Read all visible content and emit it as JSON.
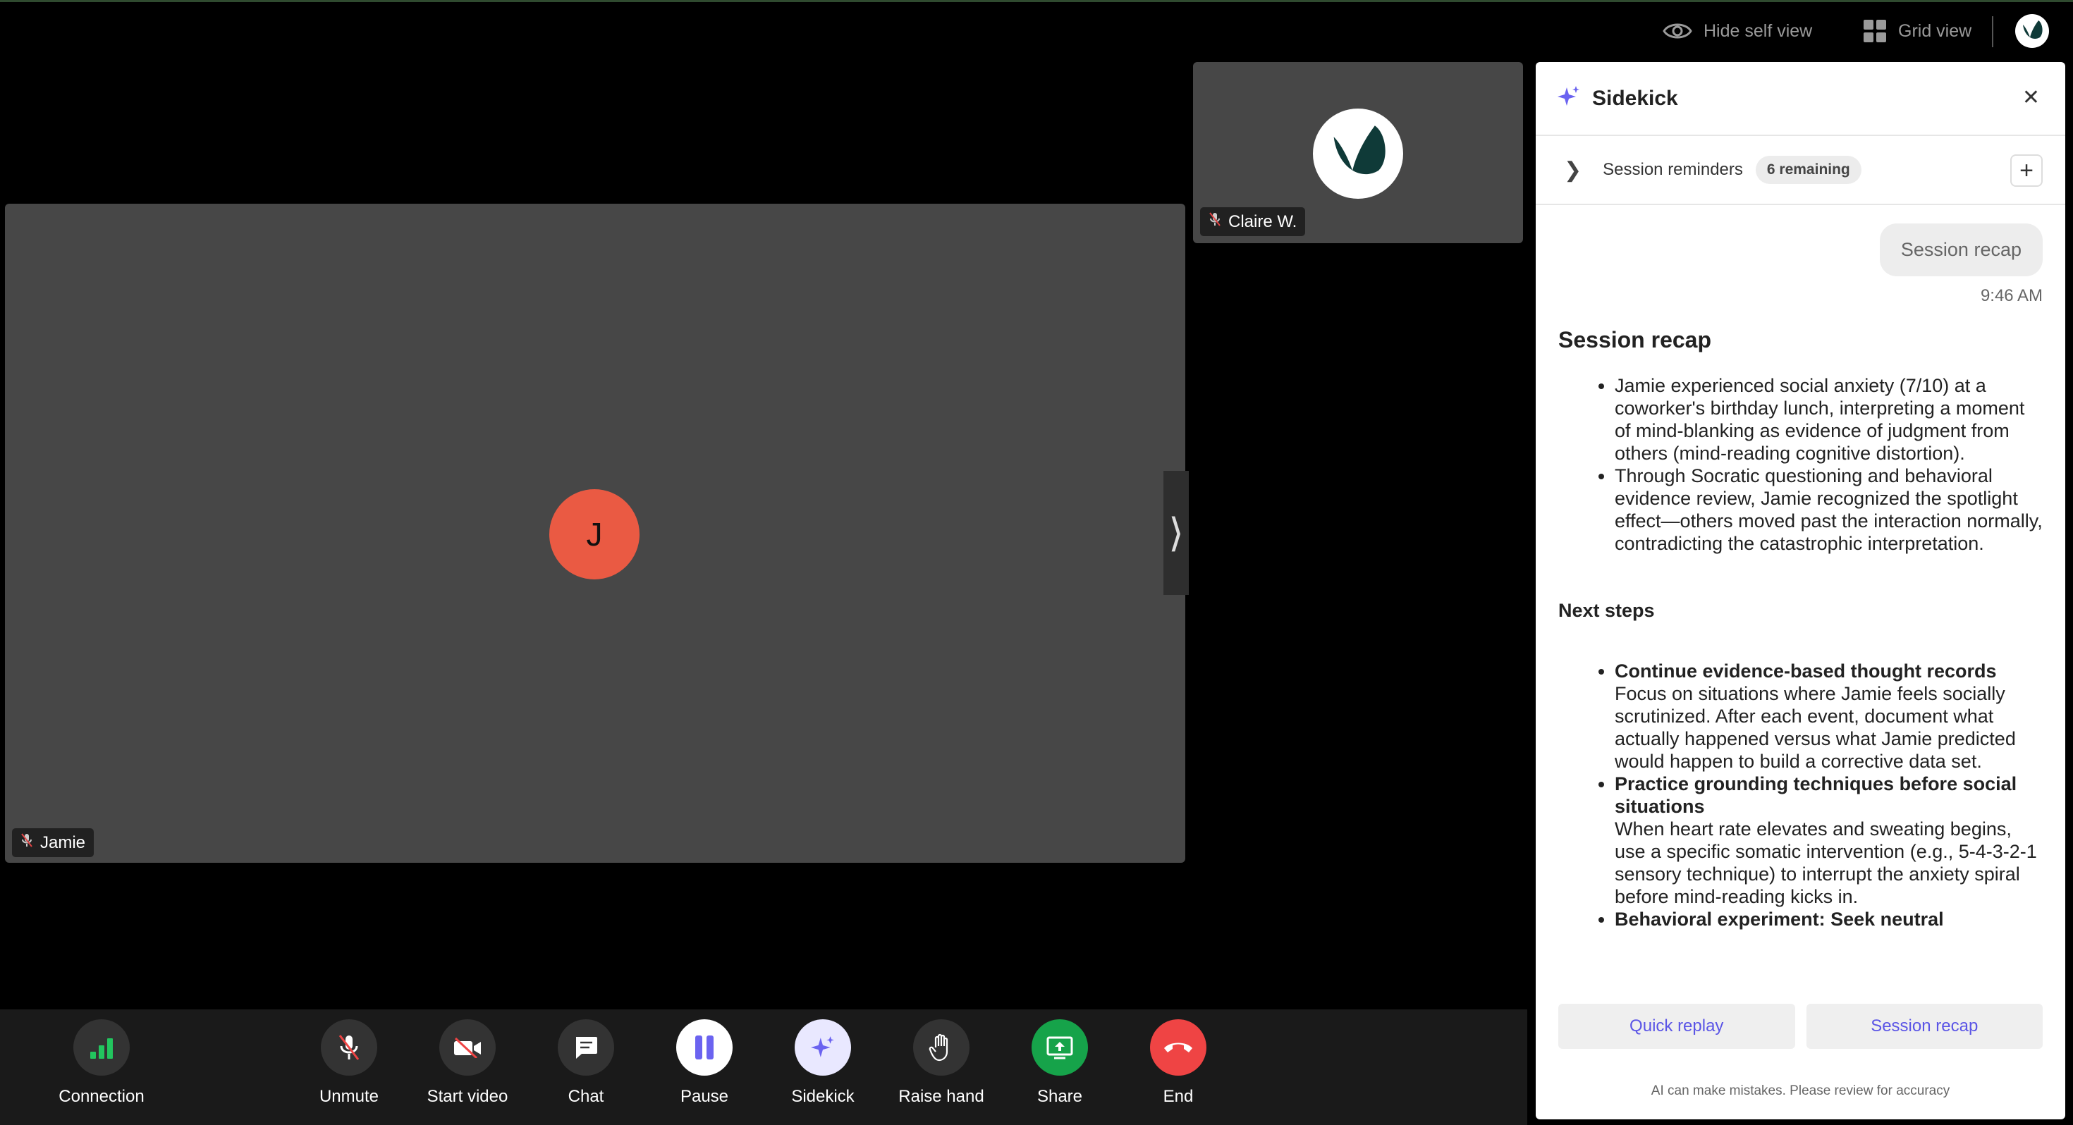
{
  "topbar": {
    "hide_self_view": "Hide self view",
    "grid_view": "Grid view"
  },
  "main_video": {
    "avatar_initial": "J",
    "avatar_color": "#ea5a43",
    "participant_name": "Jamie"
  },
  "side_video": {
    "participant_name": "Claire W."
  },
  "sidekick": {
    "title": "Sidekick",
    "reminders_label": "Session reminders",
    "reminders_badge": "6 remaining",
    "user_message": "Session recap",
    "timestamp": "9:46 AM",
    "recap_heading": "Session recap",
    "recap_items": [
      "Jamie experienced social anxiety (7/10) at a coworker's birthday lunch, interpreting a moment of mind-blanking as evidence of judgment from others (mind-reading cognitive distortion).",
      "Through Socratic questioning and behavioral evidence review, Jamie recognized the spotlight effect—others moved past the interaction normally, contradicting the catastrophic interpretation."
    ],
    "next_steps_heading": "Next steps",
    "next_steps": [
      {
        "title": "Continue evidence-based thought records",
        "body": "Focus on situations where Jamie feels socially scrutinized. After each event, document what actually happened versus what Jamie predicted would happen to build a corrective data set."
      },
      {
        "title": "Practice grounding techniques before social situations",
        "body": "When heart rate elevates and sweating begins, use a specific somatic intervention (e.g., 5-4-3-2-1 sensory technique) to interrupt the anxiety spiral before mind-reading kicks in."
      },
      {
        "title": "Behavioral experiment: Seek neutral",
        "body": ""
      }
    ],
    "quick_replay": "Quick replay",
    "session_recap_btn": "Session recap",
    "disclaimer": "AI can make mistakes. Please review for accuracy",
    "accent_color": "#5b55e6"
  },
  "toolbar": {
    "connection": "Connection",
    "unmute": "Unmute",
    "start_video": "Start video",
    "chat": "Chat",
    "pause": "Pause",
    "sidekick": "Sidekick",
    "raise_hand": "Raise hand",
    "share": "Share",
    "end": "End",
    "share_color": "#16a34a",
    "end_color": "#ef4444"
  }
}
